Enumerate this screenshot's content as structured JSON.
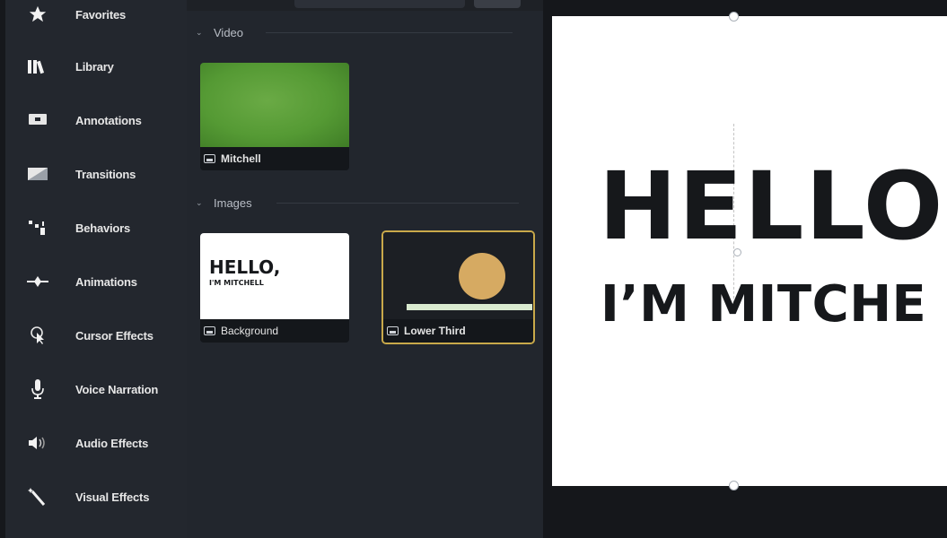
{
  "sidebar": {
    "items": [
      {
        "label": "Favorites",
        "icon": "star-icon"
      },
      {
        "label": "Library",
        "icon": "library-icon"
      },
      {
        "label": "Annotations",
        "icon": "annotation-icon"
      },
      {
        "label": "Transitions",
        "icon": "transition-icon"
      },
      {
        "label": "Behaviors",
        "icon": "behaviors-icon"
      },
      {
        "label": "Animations",
        "icon": "animation-icon"
      },
      {
        "label": "Cursor Effects",
        "icon": "cursor-icon"
      },
      {
        "label": "Voice Narration",
        "icon": "microphone-icon"
      },
      {
        "label": "Audio Effects",
        "icon": "speaker-icon"
      },
      {
        "label": "Visual Effects",
        "icon": "magic-wand-icon"
      }
    ]
  },
  "media": {
    "video_section": "Video",
    "images_section": "Images",
    "clips": {
      "mitchell": {
        "caption": "Mitchell"
      },
      "background": {
        "caption": "Background",
        "thumb_line1": "HELLO,",
        "thumb_line2": "I'M MITCHELL"
      },
      "lower_third": {
        "caption": "Lower Third"
      }
    }
  },
  "canvas": {
    "title_line1": "HELLO",
    "title_line2": "I’M MITCHE"
  },
  "colors": {
    "accent_selected": "#c9a94a",
    "video_green": "#5a9c3a",
    "lower_third_circle": "#d6aa62",
    "lower_third_bar": "#d9ead0"
  }
}
